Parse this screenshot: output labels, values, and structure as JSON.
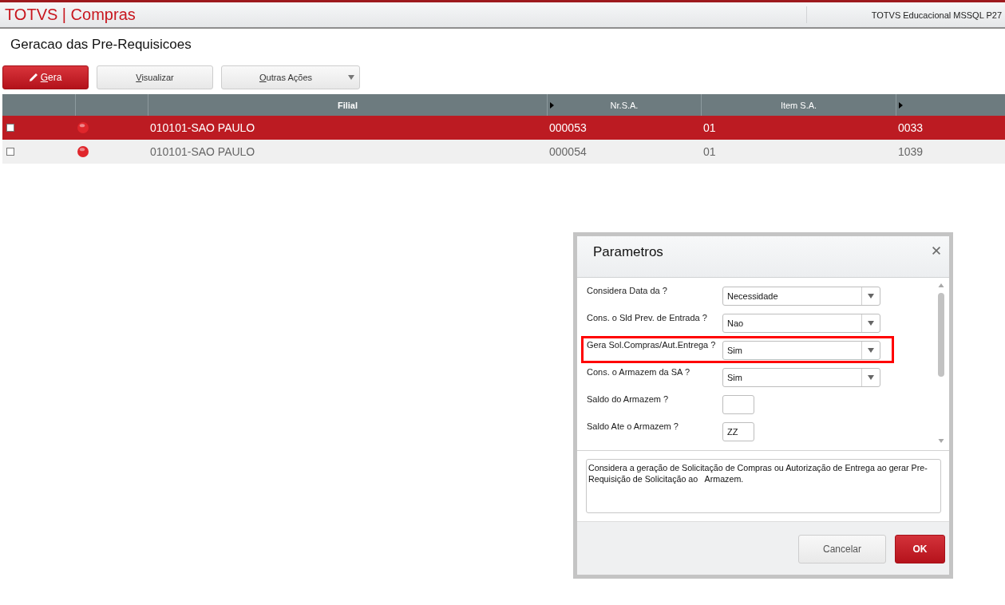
{
  "app_bar": {
    "title": "TOTVS | Compras",
    "environment": "TOTVS Educacional MSSQL P27"
  },
  "page_title": "Geracao das Pre-Requisicoes",
  "toolbar": [
    {
      "kind": "primary",
      "label": "Gera"
    },
    {
      "kind": "default",
      "label": "Visualizar"
    },
    {
      "kind": "menu",
      "label": "Outras Ações"
    }
  ],
  "table": {
    "columns": [
      {
        "arrow": false
      },
      {
        "arrow": false
      },
      {
        "label": "Filial",
        "arrow": false,
        "sorted": true
      },
      {
        "label": "Nr.S.A.",
        "arrow": true,
        "sorted": false
      },
      {
        "label": "Item S.A.",
        "arrow": false,
        "sorted": false
      },
      {
        "arrow": true
      }
    ],
    "rows": [
      {
        "selected": true,
        "checked": false,
        "color": "#e0262b",
        "filial": "010101-SAO PAULO",
        "nr_sa": "000053",
        "item_sa": "01",
        "column_6": "0033"
      },
      {
        "selected": false,
        "checked": false,
        "color": "#e0262b",
        "filial": "010101-SAO PAULO",
        "nr_sa": "000054",
        "item_sa": "01",
        "column_6": "1039"
      }
    ]
  },
  "dialog": {
    "title": "Parametros",
    "params": [
      {
        "kind": "select",
        "label": "Considera Data da ?",
        "value": "Necessidade",
        "highlighted": false
      },
      {
        "kind": "select",
        "label": "Cons. o Sld Prev. de Entrada ?",
        "value": "Nao",
        "highlighted": false
      },
      {
        "kind": "select",
        "label": "Gera Sol.Compras/Aut.Entrega ?",
        "value": "Sim",
        "highlighted": true
      },
      {
        "kind": "select",
        "label": "Cons. o Armazem da SA ?",
        "value": "Sim",
        "highlighted": false
      },
      {
        "kind": "text",
        "label": "Saldo do Armazem ?",
        "highlighted": false
      },
      {
        "kind": "text",
        "label": "Saldo Ate o Armazem ?",
        "value": "ZZ",
        "highlighted": false
      }
    ],
    "description": "Considera a geração de Solicitação de Compras ou Autorização de Entrega ao gerar Pre-Requisição de Solicitação ao   Armazem.",
    "buttons": [
      {
        "kind": "secondary",
        "label": "Cancelar"
      },
      {
        "kind": "primary",
        "label": "OK"
      }
    ]
  }
}
